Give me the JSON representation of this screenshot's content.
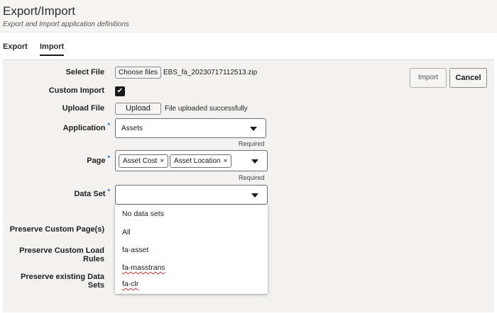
{
  "header": {
    "title": "Export/Import",
    "subtitle": "Export and Import application definitions"
  },
  "tabs": [
    {
      "label": "Export"
    },
    {
      "label": "Import"
    }
  ],
  "form": {
    "select_file": {
      "label": "Select File",
      "button": "Choose files",
      "file_name": "EBS_fa_20230717112513.zip"
    },
    "custom_import": {
      "label": "Custom Import",
      "checked": true
    },
    "upload_file": {
      "label": "Upload File",
      "button": "Upload",
      "status": "File uploaded successfully"
    },
    "application": {
      "label": "Application",
      "value": "Assets",
      "required_text": "Required"
    },
    "page": {
      "label": "Page",
      "chips": [
        "Asset Cost",
        "Asset Location"
      ],
      "required_text": "Required"
    },
    "data_set": {
      "label": "Data Set",
      "value": "",
      "options": [
        "No data sets",
        "All",
        "fa-asset",
        "fa-masstrans",
        "fa-clr"
      ]
    },
    "preserve_pages": {
      "label": "Preserve Custom Page(s)"
    },
    "preserve_load_rules": {
      "label_line1": "Preserve Custom Load",
      "label_line2": "Rules"
    },
    "preserve_data_sets": {
      "label": "Preserve existing Data Sets"
    }
  },
  "actions": {
    "import": "Import",
    "cancel": "Cancel"
  },
  "icons": {
    "required_marker": "*",
    "chip_remove": "×",
    "check": "✔"
  }
}
